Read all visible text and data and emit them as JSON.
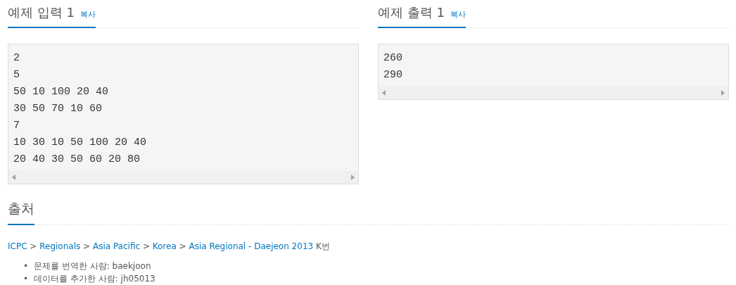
{
  "samples": [
    {
      "title": "예제 입력 1",
      "copy": "복사",
      "lines": [
        "2",
        "5",
        "50 10 100 20 40",
        "30 50 70 10 60",
        "7",
        "10 30 10 50 100 20 40",
        "20 40 30 50 60 20 80"
      ]
    },
    {
      "title": "예제 출력 1",
      "copy": "복사",
      "lines": [
        "260",
        "290"
      ]
    }
  ],
  "source": {
    "title": "출처",
    "breadcrumb": {
      "links": [
        "ICPC",
        "Regionals",
        "Asia Pacific",
        "Korea",
        "Asia Regional - Daejeon 2013"
      ],
      "separator": ">",
      "suffix": "K번"
    },
    "credits": [
      {
        "marker": "•",
        "text": "문제를 번역한 사람: baekjoon"
      },
      {
        "marker": "•",
        "text": "데이터를 추가한 사람: jh05013"
      }
    ]
  }
}
